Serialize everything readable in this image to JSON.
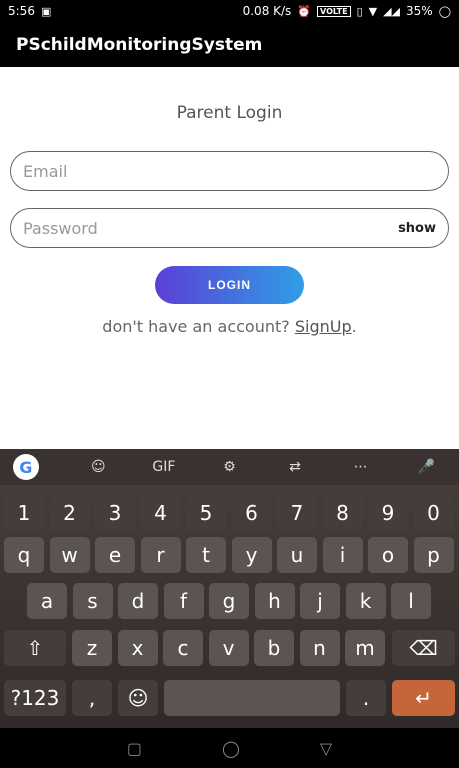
{
  "status": {
    "time": "5:56",
    "speed": "0.08 K/s",
    "volte": "VOLTE",
    "battery": "35%"
  },
  "app": {
    "title": "PSchildMonitoringSystem"
  },
  "login": {
    "heading": "Parent Login",
    "email_placeholder": "Email",
    "password_placeholder": "Password",
    "show_label": "show",
    "button_label": "LOGIN",
    "signup_prompt": "don't have an account?",
    "signup_link": "SignUp",
    "signup_suffix": "."
  },
  "keyboard": {
    "toolbar": [
      "G",
      "sticker-icon",
      "GIF",
      "gear-icon",
      "translate-icon",
      "more-icon",
      "mic-icon"
    ],
    "numbers": [
      "1",
      "2",
      "3",
      "4",
      "5",
      "6",
      "7",
      "8",
      "9",
      "0"
    ],
    "row1": [
      "q",
      "w",
      "e",
      "r",
      "t",
      "y",
      "u",
      "i",
      "o",
      "p"
    ],
    "row2": [
      "a",
      "s",
      "d",
      "f",
      "g",
      "h",
      "j",
      "k",
      "l"
    ],
    "row3": [
      "z",
      "x",
      "c",
      "v",
      "b",
      "n",
      "m"
    ],
    "symbols_label": "?123",
    "comma": ",",
    "period": "."
  }
}
